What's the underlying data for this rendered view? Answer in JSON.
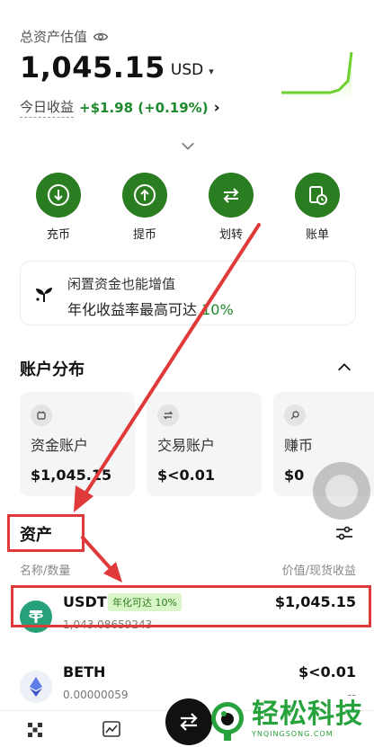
{
  "header": {
    "total_label": "总资产估值",
    "balance": "1,045.15",
    "currency": "USD",
    "today_label": "今日收益",
    "today_value": "+$1.98 (+0.19%)",
    "today_chevron": "›"
  },
  "actions": [
    {
      "label": "充币",
      "icon": "deposit-icon"
    },
    {
      "label": "提币",
      "icon": "withdraw-icon"
    },
    {
      "label": "划转",
      "icon": "transfer-icon"
    },
    {
      "label": "账单",
      "icon": "bill-icon"
    }
  ],
  "promo": {
    "line1": "闲置资金也能增值",
    "line2_prefix": "年化收益率最高可达 ",
    "line2_highlight": "10%"
  },
  "distribution": {
    "title": "账户分布",
    "cards": [
      {
        "name": "资金账户",
        "value": "$1,045.15"
      },
      {
        "name": "交易账户",
        "value": "$<0.01"
      },
      {
        "name": "赚币",
        "value": "$0"
      }
    ]
  },
  "assets": {
    "title": "资产",
    "col_left": "名称/数量",
    "col_right": "价值/现货收益",
    "rows": [
      {
        "symbol": "USDT",
        "badge": "年化可达 10%",
        "quantity": "1,043.08659243",
        "value": "$1,045.15",
        "pnl": "--"
      },
      {
        "symbol": "BETH",
        "badge": "",
        "quantity": "0.00000059",
        "value": "$<0.01",
        "pnl": "--"
      }
    ]
  },
  "watermark": {
    "title": "轻松科技",
    "subtitle": "YNQINGSONG.COM"
  },
  "colors": {
    "accent": "#2a7d21",
    "gain": "#1d8a2b",
    "annotation": "#e0393a"
  }
}
